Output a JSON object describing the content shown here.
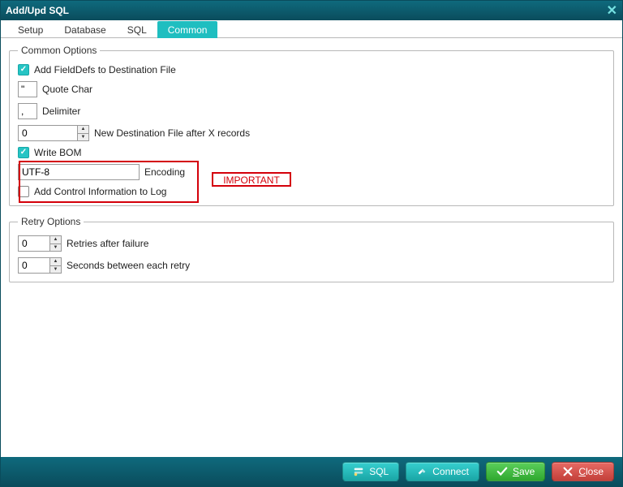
{
  "window": {
    "title": "Add/Upd SQL"
  },
  "tabs": [
    {
      "label": "Setup",
      "active": false
    },
    {
      "label": "Database",
      "active": false
    },
    {
      "label": "SQL",
      "active": false
    },
    {
      "label": "Common",
      "active": true
    }
  ],
  "common": {
    "legend": "Common Options",
    "add_fielddefs": {
      "label": "Add FieldDefs to Destination File",
      "checked": true
    },
    "quote_char": {
      "label": "Quote Char",
      "value": "\""
    },
    "delimiter": {
      "label": "Delimiter",
      "value": ","
    },
    "new_dest": {
      "label": "New Destination File after X records",
      "value": "0"
    },
    "write_bom": {
      "label": "Write BOM",
      "checked": true
    },
    "encoding": {
      "label": "Encoding",
      "value": "UTF-8"
    },
    "add_ctrl_log": {
      "label": "Add Control Information to Log",
      "checked": false
    }
  },
  "retry": {
    "legend": "Retry Options",
    "retries": {
      "label": "Retries after failure",
      "value": "0"
    },
    "seconds": {
      "label": "Seconds between each retry",
      "value": "0"
    }
  },
  "annotation": {
    "important": "IMPORTANT"
  },
  "footer": {
    "sql": "SQL",
    "connect": "Connect",
    "save_prefix": "S",
    "save_rest": "ave",
    "close_prefix": "C",
    "close_rest": "lose"
  }
}
